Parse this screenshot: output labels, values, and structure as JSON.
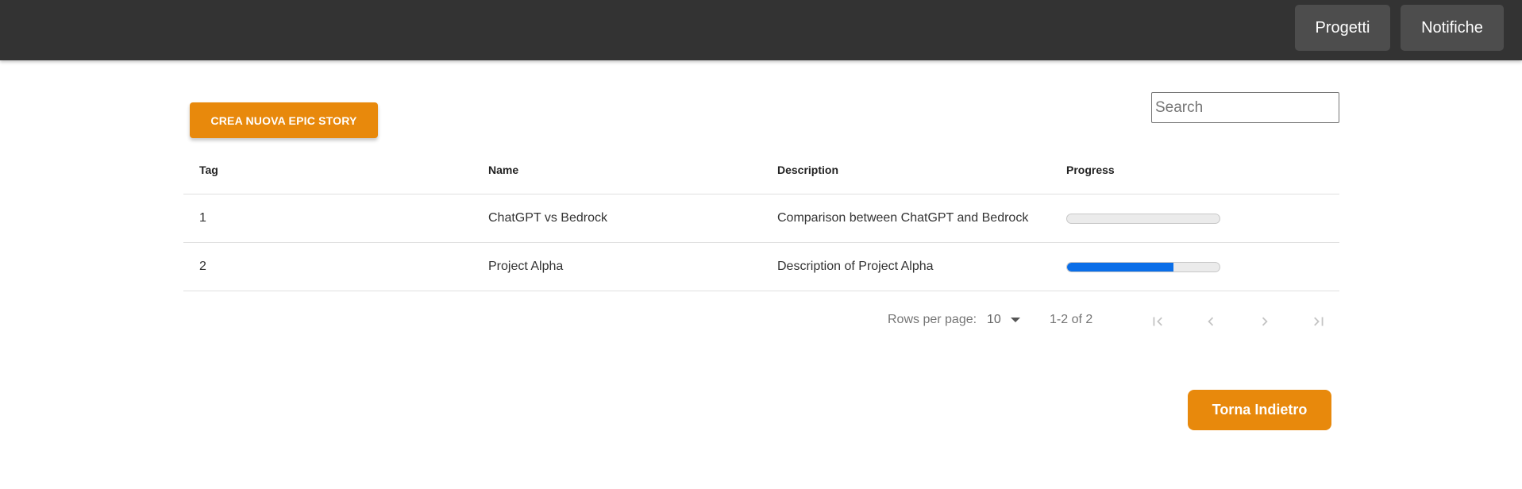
{
  "nav": {
    "projects_label": "Progetti",
    "notifications_label": "Notifiche"
  },
  "toolbar": {
    "create_label": "CREA NUOVA EPIC STORY",
    "search_placeholder": "Search",
    "search_value": ""
  },
  "table": {
    "columns": [
      "Tag",
      "Name",
      "Description",
      "Progress"
    ],
    "rows": [
      {
        "tag": "1",
        "name": "ChatGPT vs Bedrock",
        "description": "Comparison between ChatGPT and Bedrock",
        "progress": 0
      },
      {
        "tag": "2",
        "name": "Project Alpha",
        "description": "Description of Project Alpha",
        "progress": 70
      }
    ]
  },
  "pagination": {
    "rows_per_page_label": "Rows per page:",
    "rows_per_page_value": "10",
    "range_text": "1-2 of 2",
    "icons": [
      "first-page-icon",
      "previous-page-icon",
      "next-page-icon",
      "last-page-icon"
    ]
  },
  "footer": {
    "back_label": "Torna Indietro"
  },
  "colors": {
    "topbar": "#333333",
    "nav_button": "#4d4d4d",
    "accent": "#e8890c",
    "progress_fill": "#0a6ee8",
    "progress_track": "#ebebeb"
  }
}
